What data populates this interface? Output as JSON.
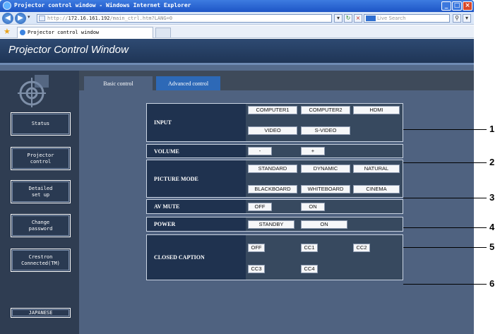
{
  "browser": {
    "window_title": "Projector control window - Windows Internet Explorer",
    "address_prefix": "http://",
    "address_host": "172.16.161.192",
    "address_path": "/main_ctrl.htm?LANG=0",
    "search_placeholder": "Live Search",
    "tab_title": "Projector control window"
  },
  "app": {
    "title": "Projector Control Window"
  },
  "sidebar": {
    "items": [
      {
        "label": "Status"
      },
      {
        "label": "Projector\ncontrol"
      },
      {
        "label": "Detailed\nset up"
      },
      {
        "label": "Change\npassword"
      },
      {
        "label": "Crestron\nConnected(TM)"
      }
    ],
    "language_button": "JAPANESE"
  },
  "tabs": {
    "basic": "Basic control",
    "advanced": "Advanced control"
  },
  "controls": {
    "input": {
      "label": "INPUT",
      "buttons": [
        "COMPUTER1",
        "COMPUTER2",
        "HDMI",
        "VIDEO",
        "S-VIDEO"
      ]
    },
    "volume": {
      "label": "VOLUME",
      "buttons": [
        "-",
        "+"
      ]
    },
    "picture_mode": {
      "label": "PICTURE MODE",
      "buttons": [
        "STANDARD",
        "DYNAMIC",
        "NATURAL",
        "BLACKBOARD",
        "WHITEBOARD",
        "CINEMA"
      ]
    },
    "av_mute": {
      "label": "AV MUTE",
      "buttons": [
        "OFF",
        "ON"
      ]
    },
    "power": {
      "label": "POWER",
      "buttons": [
        "STANDBY",
        "ON"
      ]
    },
    "closed_caption": {
      "label": "CLOSED CAPTION",
      "buttons": [
        "OFF",
        "CC1",
        "CC2",
        "CC3",
        "CC4"
      ]
    }
  },
  "callouts": [
    "1",
    "2",
    "3",
    "4",
    "5",
    "6"
  ],
  "colors": {
    "titlebar": "#1d55c6",
    "app_header": "#1f3556",
    "active_tab": "#4f6280",
    "inactive_tab": "#2d69b7",
    "row_label_bg": "#1f324f",
    "close_button": "#d8482a"
  }
}
